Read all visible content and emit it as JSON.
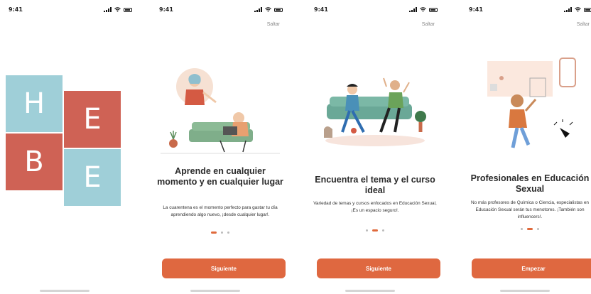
{
  "status": {
    "time": "9:41"
  },
  "colors": {
    "accent": "#df6840",
    "teal": "#9fcfd8",
    "red": "#cf6255"
  },
  "screens": [
    {
      "logo_letters": [
        "H",
        "E",
        "B",
        "E"
      ]
    },
    {
      "skip": "Saltar",
      "title": "Aprende en cualquier momento y en cualquier lugar",
      "desc": "La cuarentena es el momento perfecto para gastar tu día aprendiendo algo nuevo, ¡desde cualquier lugar!.",
      "cta": "Siguiente",
      "active_dot": 0
    },
    {
      "skip": "Saltar",
      "title": "Encuentra el tema y el curso ideal",
      "desc": "Variedad de temas y cursos enfocados en Educación Sexual, ¡Es un espacio seguro!.",
      "cta": "Siguiente",
      "active_dot": 1
    },
    {
      "skip": "Saltar",
      "title": "Profesionales en Educación Sexual",
      "desc": "No más profesores de Química o Ciencia, especialistas en Educación Sexual serán tus menotores. ¡También son influencers!.",
      "cta": "Empezar",
      "active_dot": 1
    }
  ]
}
